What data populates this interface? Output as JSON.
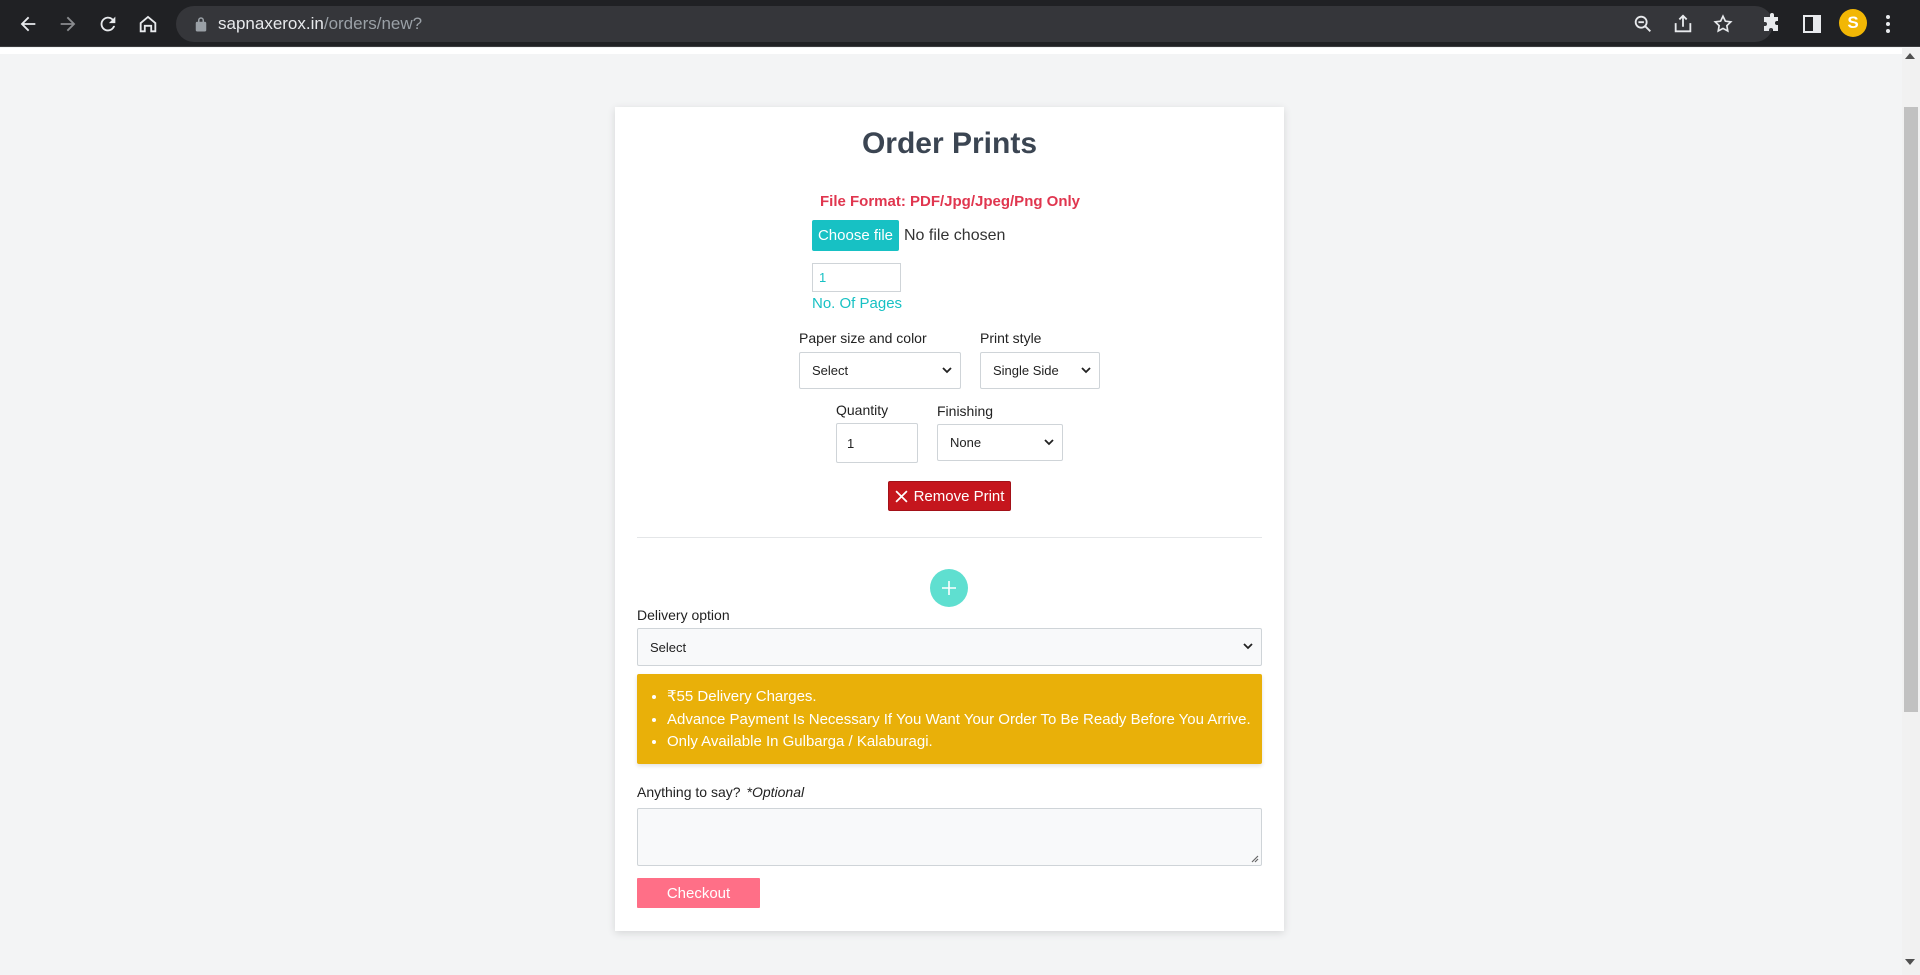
{
  "browser": {
    "url_host": "sapnaxerox.in",
    "url_path": "/orders/new?",
    "avatar_letter": "S"
  },
  "form": {
    "title": "Order Prints",
    "file_format_note": "File Format: PDF/Jpg/Jpeg/Png Only",
    "choose_file_label": "Choose file",
    "no_file_text": "No file chosen",
    "pages_value": "1",
    "pages_label": "No. Of Pages",
    "paper_size_label": "Paper size and color",
    "paper_size_value": "Select",
    "print_style_label": "Print style",
    "print_style_value": "Single Side",
    "quantity_label": "Quantity",
    "quantity_value": "1",
    "finishing_label": "Finishing",
    "finishing_value": "None",
    "remove_print_label": "Remove Print",
    "delivery_label": "Delivery option",
    "delivery_value": "Select",
    "info_items": [
      "₹55 Delivery Charges.",
      "Advance Payment Is Necessary If You Want Your Order To Be Ready Before You Arrive.",
      "Only Available In Gulbarga / Kalaburagi."
    ],
    "anything_label": "Anything to say?",
    "optional_label": "*Optional",
    "checkout_label": "Checkout"
  },
  "colors": {
    "accent_teal": "#17c1c4",
    "danger": "#c5161d",
    "warning": "#e9b009",
    "checkout_pink": "#ff6f87"
  }
}
